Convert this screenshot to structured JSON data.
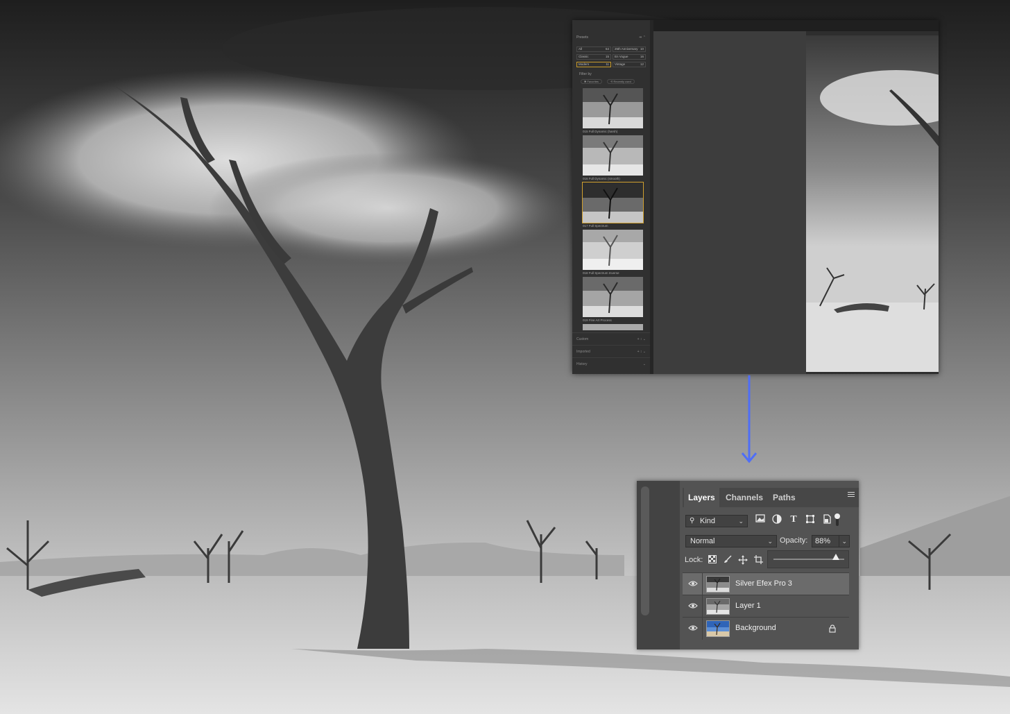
{
  "silver_efex": {
    "presets_title": "Presets",
    "presets_ctrl": "⇹ ⌃",
    "categories": [
      {
        "label": "All",
        "count": "64"
      },
      {
        "label": "25th Anniversary",
        "count": "10"
      },
      {
        "label": "Classic",
        "count": "15"
      },
      {
        "label": "En Vogue",
        "count": "16"
      },
      {
        "label": "Modern",
        "count": "11"
      },
      {
        "label": "Vintage",
        "count": "12"
      }
    ],
    "filter_label": "Filter by",
    "filter_chips": [
      "✱ Favorites",
      "⟲ Recently used"
    ],
    "thumbnails": [
      {
        "label": "015 Full Dynamic (harsh)"
      },
      {
        "label": "016 Full Dynamic (smooth)"
      },
      {
        "label": "017 Full Spectrum"
      },
      {
        "label": "018 Full Spectrum Inverse"
      },
      {
        "label": "019 Fine Art Process"
      }
    ],
    "folds": [
      {
        "title": "Custom",
        "ctrl": "+ ↕ ⌄"
      },
      {
        "title": "Imported",
        "ctrl": "+ ↕ ⌄"
      },
      {
        "title": "History",
        "ctrl": "⌄"
      }
    ],
    "selected_category_color": "#c89b2b"
  },
  "layers_panel": {
    "tabs": [
      "Layers",
      "Channels",
      "Paths"
    ],
    "filter_kind": "Kind",
    "blend_mode": "Normal",
    "opacity_label": "Opacity:",
    "opacity_value": "88%",
    "opacity_fraction": 0.88,
    "lock_label": "Lock:",
    "filter_icons": [
      "image-filter-icon",
      "adjustment-filter-icon",
      "type-filter-icon",
      "shape-filter-icon",
      "smart-object-filter-icon",
      "filter-toggle-icon"
    ],
    "lock_icons": [
      "lock-transparency-icon",
      "lock-paint-icon",
      "lock-position-icon",
      "lock-artboard-icon"
    ],
    "layers": [
      {
        "name": "Silver Efex Pro 3",
        "selected": true,
        "locked": false
      },
      {
        "name": "Layer 1",
        "selected": false,
        "locked": false
      },
      {
        "name": "Background",
        "selected": false,
        "locked": true
      }
    ]
  },
  "arrow_color": "#4f6ef7"
}
